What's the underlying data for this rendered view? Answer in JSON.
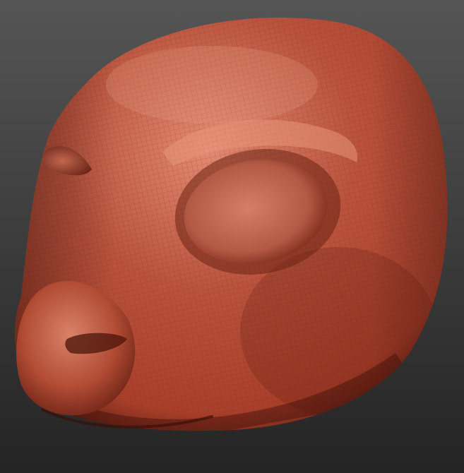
{
  "viewport": {
    "background_top": "#555555",
    "background_bottom": "#242424"
  },
  "model": {
    "material": {
      "base": "#a83f2a",
      "highlight": "#e38b73",
      "mid": "#b9533d",
      "shadow": "#5a1a10",
      "deep_shadow": "#3a0f08",
      "wire": "#7d2a1c"
    },
    "parts": [
      "sculpt-head",
      "eye-socket-right",
      "eye-socket-left",
      "snout",
      "nose",
      "mouth-line"
    ]
  }
}
